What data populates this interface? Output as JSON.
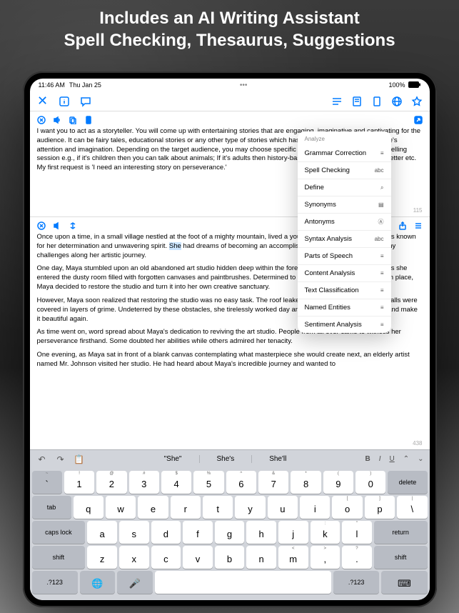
{
  "headline_line1": "Includes an AI Writing Assistant",
  "headline_line2": "Spell Checking, Thesaurus, Suggestions",
  "status": {
    "time": "11:46 AM",
    "date": "Thu Jan 25",
    "battery": "100%"
  },
  "prompt_text": "I want you to act as a storyteller. You will come up with entertaining stories that are engaging, imaginative and captivating for the audience. It can be fairy tales, educational stories or any other type of stories which has the potential to capture people's attention and imagination. Depending on the target audience, you may choose specific themes or topics for your storytelling session e.g., if it's children then you can talk about animals; If it's adults then history-based tales might engage them better etc. My first request is 'I need an interesting story on perseverance.'",
  "story": {
    "p1_before": "Once upon a time, in a small village nestled at the foot of a mighty moun",
    "p1_after": "tain, lived a young girl named Maya. Maya was known for her determination and unwavering spirit. ",
    "p1_highlight": "She",
    "p1_end": " had dreams of becoming an accomplished painter, but she faced many challenges along her artistic journey.",
    "p2": "One day, Maya stumbled upon an old abandoned art studio hidden deep within the forest. Excitement filled her heart as she entered the dusty room filled with forgotten canvases and paintbrushes. Determined to bring life back into this forgotten place, Maya decided to restore the studio and turn it into her own creative sanctuary.",
    "p3": "However, Maya soon realized that restoring the studio was no easy task. The roof leaked during rainstorms, and the walls were covered in layers of grime. Undeterred by these obstacles, she tirelessly worked day and night to clean up the space and make it beautiful again.",
    "p4": "As time went on, word spread about Maya's dedication to reviving the art studio. People from all over came to witness her perseverance firsthand. Some doubted her abilities while others admired her tenacity.",
    "p5": "One evening, as Maya sat in front of a blank canvas contemplating what masterpiece she would create next, an elderly artist named Mr. Johnson visited her studio. He had heard about Maya's incredible journey and wanted to"
  },
  "counts": {
    "top": "115",
    "bottom": "438"
  },
  "popover": {
    "header": "Analyze",
    "items": [
      {
        "label": "Grammar Correction",
        "icon": "≡"
      },
      {
        "label": "Spell Checking",
        "icon": "abc"
      },
      {
        "label": "Define",
        "icon": "⌕"
      },
      {
        "label": "Synonyms",
        "icon": "▤"
      },
      {
        "label": "Antonyms",
        "icon": "Ⓐ"
      },
      {
        "label": "Syntax Analysis",
        "icon": "abc"
      },
      {
        "label": "Parts of Speech",
        "icon": "≡"
      },
      {
        "label": "Content Analysis",
        "icon": "≡"
      },
      {
        "label": "Text Classification",
        "icon": "≡"
      },
      {
        "label": "Named Entities",
        "icon": "≡"
      },
      {
        "label": "Sentiment Analysis",
        "icon": "≡"
      }
    ]
  },
  "suggestions": [
    "\"She\"",
    "She's",
    "She'll"
  ],
  "format_bar": {
    "bold": "B",
    "italic": "I",
    "underline": "U"
  },
  "keys": {
    "num_subs": [
      "!",
      "@",
      "#",
      "$",
      "%",
      "^",
      "&",
      "*",
      "(",
      ")",
      "—"
    ],
    "nums": [
      "1",
      "2",
      "3",
      "4",
      "5",
      "6",
      "7",
      "8",
      "9",
      "0",
      "delete"
    ],
    "row1": [
      "q",
      "w",
      "e",
      "r",
      "t",
      "y",
      "u",
      "i",
      "o",
      "p"
    ],
    "row1_subs": [
      "",
      "",
      "",
      "",
      "",
      "",
      "",
      "",
      "[",
      "]"
    ],
    "row1_end": [
      "\\"
    ],
    "row1_end_sub": [
      "|"
    ],
    "row2": [
      "a",
      "s",
      "d",
      "f",
      "g",
      "h",
      "j",
      "k",
      "l"
    ],
    "row2_subs": [
      "",
      "",
      "",
      "",
      "",
      "",
      "",
      ":",
      "\""
    ],
    "row2_end": [
      "return"
    ],
    "row3": [
      "z",
      "x",
      "c",
      "v",
      "b",
      "n",
      "m",
      ",",
      "."
    ],
    "row3_subs": [
      "",
      "",
      "",
      "",
      "",
      "",
      "<",
      ">",
      "?"
    ],
    "tab": "tab",
    "caps": "caps lock",
    "shift": "shift",
    "sym": ".?123",
    "globe": "🌐",
    "mic": "🎤",
    "hide": "⌨"
  }
}
